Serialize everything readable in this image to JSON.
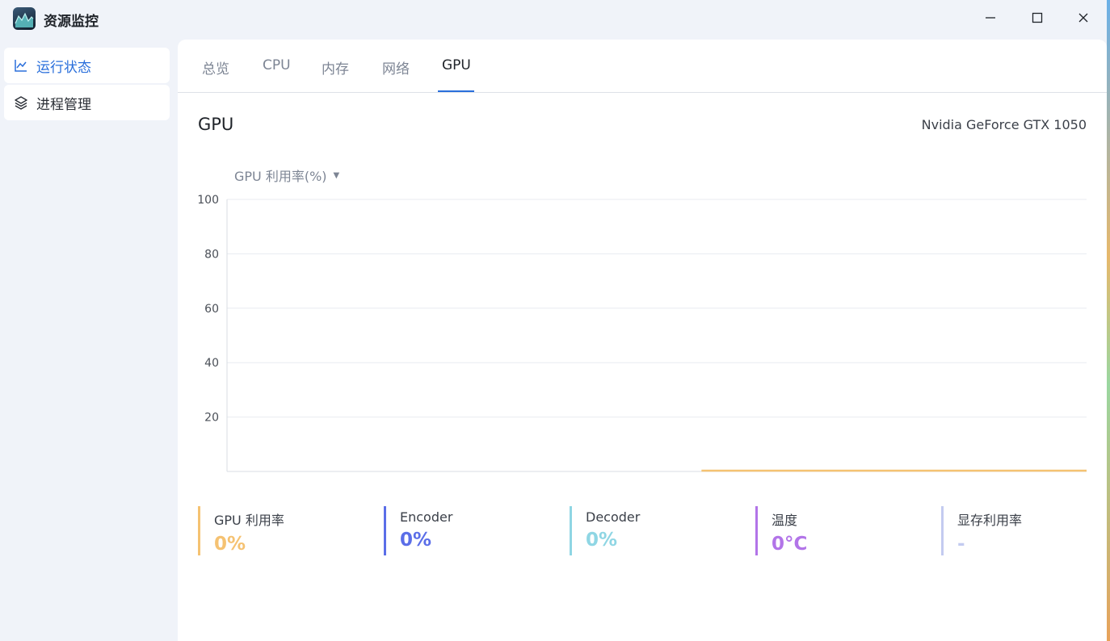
{
  "app": {
    "title": "资源监控"
  },
  "window_controls": {
    "minimize": "minimize-icon",
    "maximize": "maximize-icon",
    "close": "close-icon"
  },
  "sidebar": {
    "items": [
      {
        "label": "运行状态",
        "icon": "line-chart-icon",
        "active": true
      },
      {
        "label": "进程管理",
        "icon": "layers-icon",
        "active": false
      }
    ]
  },
  "tabs": [
    {
      "label": "总览",
      "active": false
    },
    {
      "label": "CPU",
      "active": false
    },
    {
      "label": "内存",
      "active": false
    },
    {
      "label": "网络",
      "active": false
    },
    {
      "label": "GPU",
      "active": true
    }
  ],
  "section": {
    "title": "GPU",
    "device_name": "Nvidia GeForce GTX 1050"
  },
  "metric_select": {
    "value": "GPU 利用率(%)"
  },
  "chart_data": {
    "type": "line",
    "title": "",
    "xlabel": "",
    "ylabel": "",
    "ylim": [
      0,
      100
    ],
    "yticks": [
      "100",
      "80",
      "60",
      "40",
      "20"
    ],
    "grid": true,
    "series": [
      {
        "color": "#f5c272",
        "x_start_fraction": 0.552,
        "values": [
          0,
          0
        ]
      }
    ]
  },
  "stats": [
    {
      "label": "GPU 利用率",
      "value": "0%",
      "color": "#f5c272"
    },
    {
      "label": "Encoder",
      "value": "0%",
      "color": "#5b6ee8"
    },
    {
      "label": "Decoder",
      "value": "0%",
      "color": "#8fd6e4"
    },
    {
      "label": "温度",
      "value": "0°C",
      "color": "#b274e8"
    },
    {
      "label": "显存利用率",
      "value": "-",
      "color": "#c3cbf0"
    }
  ],
  "colors": {
    "accent": "#2a6fdb",
    "grid": "#e8ebf0",
    "axis": "#d9dde3"
  }
}
